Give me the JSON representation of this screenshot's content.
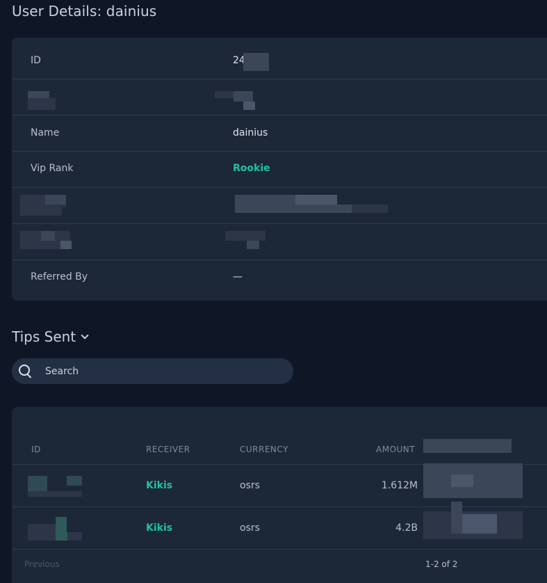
{
  "page": {
    "title": "User Details: dainius"
  },
  "details": {
    "rows": [
      {
        "label": "ID",
        "value": "24"
      },
      {
        "label": "",
        "value": ""
      },
      {
        "label": "Name",
        "value": "dainius"
      },
      {
        "label": "Vip Rank",
        "value": "Rookie"
      },
      {
        "label": "",
        "value": ""
      },
      {
        "label": "",
        "value": ""
      },
      {
        "label": "Referred By",
        "value": "—"
      }
    ]
  },
  "tips": {
    "title": "Tips Sent",
    "search_placeholder": "Search",
    "columns": {
      "id": "ID",
      "receiver": "RECEIVER",
      "currency": "CURRENCY",
      "amount": "AMOUNT"
    },
    "rows": [
      {
        "receiver": "Kikis",
        "currency": "osrs",
        "amount": "1.612M"
      },
      {
        "receiver": "Kikis",
        "currency": "osrs",
        "amount": "4.2B"
      }
    ],
    "pager": {
      "previous": "Previous",
      "count": "1-2 of 2"
    }
  },
  "colors": {
    "background": "#0f1727",
    "card": "#1c2738",
    "accent_green": "#1fc39b"
  },
  "icons": {
    "search": "search-icon",
    "chevron": "chevron-down-icon"
  }
}
